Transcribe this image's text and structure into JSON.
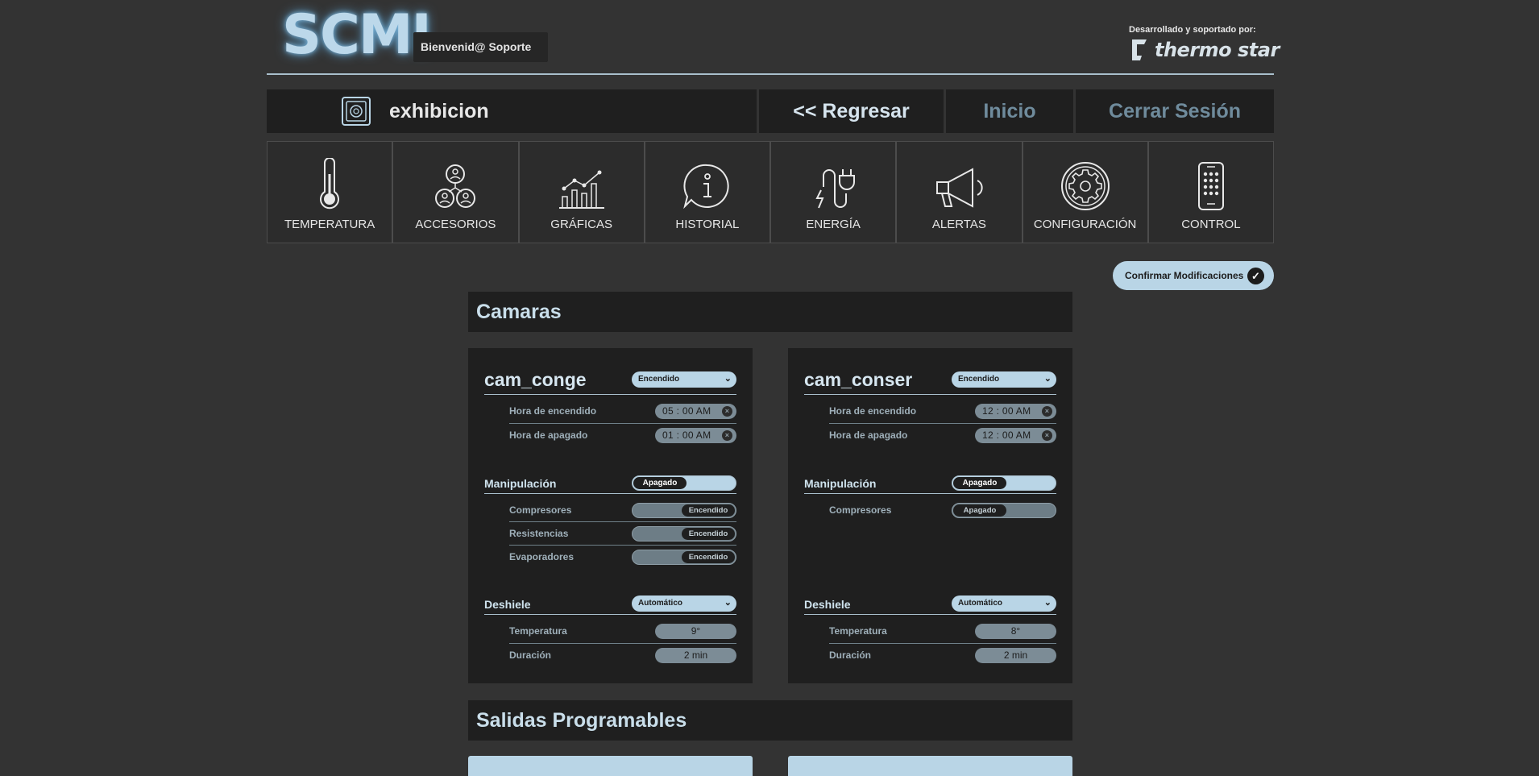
{
  "header": {
    "logo": "SCMI",
    "welcome": "Bienvenid@ Soporte",
    "developer_caption": "Desarrollado y soportado por:",
    "brand_name": "thermo star"
  },
  "nav": {
    "title": "exhibicion",
    "title_icon": "fridge-icon",
    "back_label": "<< Regresar",
    "home_label": "Inicio",
    "logout_label": "Cerrar Sesión"
  },
  "menu": [
    {
      "label": "TEMPERATURA",
      "icon": "thermometer-icon"
    },
    {
      "label": "ACCESORIOS",
      "icon": "accessories-icon"
    },
    {
      "label": "GRÁFICAS",
      "icon": "chart-icon"
    },
    {
      "label": "HISTORIAL",
      "icon": "info-icon"
    },
    {
      "label": "ENERGÍA",
      "icon": "plug-icon"
    },
    {
      "label": "ALERTAS",
      "icon": "megaphone-icon"
    },
    {
      "label": "CONFIGURACIÓN",
      "icon": "gear-icon"
    },
    {
      "label": "CONTROL",
      "icon": "remote-icon"
    }
  ],
  "confirm_label": "Confirmar Modificaciones",
  "sections": {
    "cameras_title": "Camaras",
    "outputs_title": "Salidas Programables"
  },
  "cameras": [
    {
      "name": "cam_conge",
      "status": "Encendido",
      "on_time_label": "Hora de encendido",
      "on_time": "05 : 00   AM",
      "off_time_label": "Hora de apagado",
      "off_time": "01 : 00   AM",
      "manipulation_label": "Manipulación",
      "manipulation_state": "Apagado",
      "devices": [
        {
          "label": "Compresores",
          "state": "Encendido"
        },
        {
          "label": "Resistencias",
          "state": "Encendido"
        },
        {
          "label": "Evaporadores",
          "state": "Encendido"
        }
      ],
      "defrost_label": "Deshiele",
      "defrost_mode": "Automático",
      "temp_label": "Temperatura",
      "temp_value": "9°",
      "duration_label": "Duración",
      "duration_value": "2 min"
    },
    {
      "name": "cam_conser",
      "status": "Encendido",
      "on_time_label": "Hora de encendido",
      "on_time": "12 : 00   AM",
      "off_time_label": "Hora de apagado",
      "off_time": "12 : 00   AM",
      "manipulation_label": "Manipulación",
      "manipulation_state": "Apagado",
      "devices": [
        {
          "label": "Compresores",
          "state": "Apagado"
        }
      ],
      "defrost_label": "Deshiele",
      "defrost_mode": "Automático",
      "temp_label": "Temperatura",
      "temp_value": "8°",
      "duration_label": "Duración",
      "duration_value": "2 min"
    }
  ]
}
